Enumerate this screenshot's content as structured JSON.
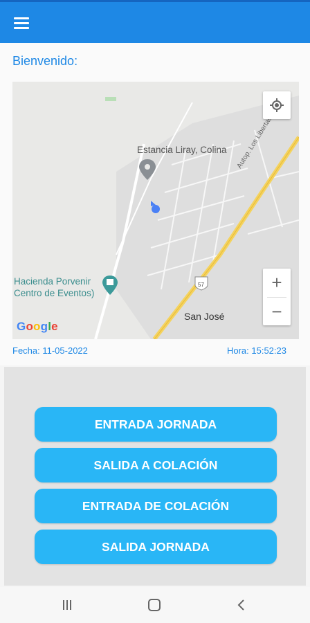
{
  "app": {
    "menu_icon": "hamburger-menu-icon",
    "accent_color": "#1e88e5",
    "button_color": "#29b6f6"
  },
  "welcome": {
    "text": "Bienvenido:"
  },
  "map": {
    "labels": {
      "estancia": "Estancia Liray, Colina",
      "hacienda_line1": "Hacienda Porvenir",
      "hacienda_line2": "Centro de Eventos)",
      "san_jose": "San José",
      "autopista": "Autop. Los Libertadores",
      "route_shield": "57"
    },
    "attribution": "Google",
    "zoom_in": "+",
    "zoom_out": "−",
    "icons": [
      "my-location-icon",
      "map-pin-icon",
      "event-venue-icon",
      "current-location-dot"
    ]
  },
  "info": {
    "fecha": "Fecha: 11-05-2022",
    "hora": "Hora: 15:52:23"
  },
  "actions": [
    {
      "label": "ENTRADA JORNADA"
    },
    {
      "label": "SALIDA A COLACIÓN"
    },
    {
      "label": "ENTRADA DE COLACIÓN"
    },
    {
      "label": "SALIDA JORNADA"
    }
  ],
  "navbar": {
    "icons": [
      "recent-apps-icon",
      "home-icon",
      "back-icon"
    ]
  }
}
